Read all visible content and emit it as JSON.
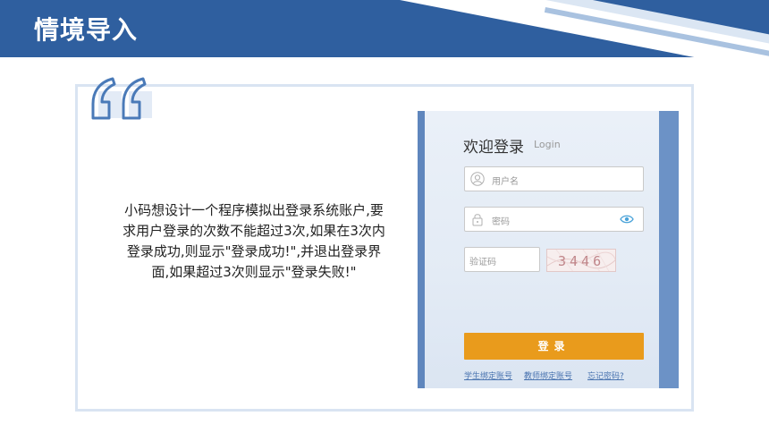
{
  "header": {
    "title": "情境导入",
    "colors": {
      "band": "#2f5f9f",
      "frame": "#d9e4f2"
    }
  },
  "intro": {
    "text": "小码想设计一个程序模拟出登录系统账户,要求用户登录的次数不能超过3次,如果在3次内登录成功,则显示\"登录成功!\",并退出登录界面,如果超过3次则显示\"登录失败!\""
  },
  "login": {
    "title": "欢迎登录",
    "subtitle": "Login",
    "username_placeholder": "用户名",
    "password_placeholder": "密码",
    "captcha_placeholder": "验证码",
    "captcha_value": "3446",
    "button_label": "登录",
    "links": {
      "student": "学生绑定账号",
      "teacher": "教师绑定账号",
      "forgot": "忘记密码?"
    },
    "colors": {
      "button": "#e99b1c",
      "panel_side": "#5f86bd"
    },
    "icons": [
      "user-icon",
      "lock-icon",
      "eye-icon"
    ]
  }
}
